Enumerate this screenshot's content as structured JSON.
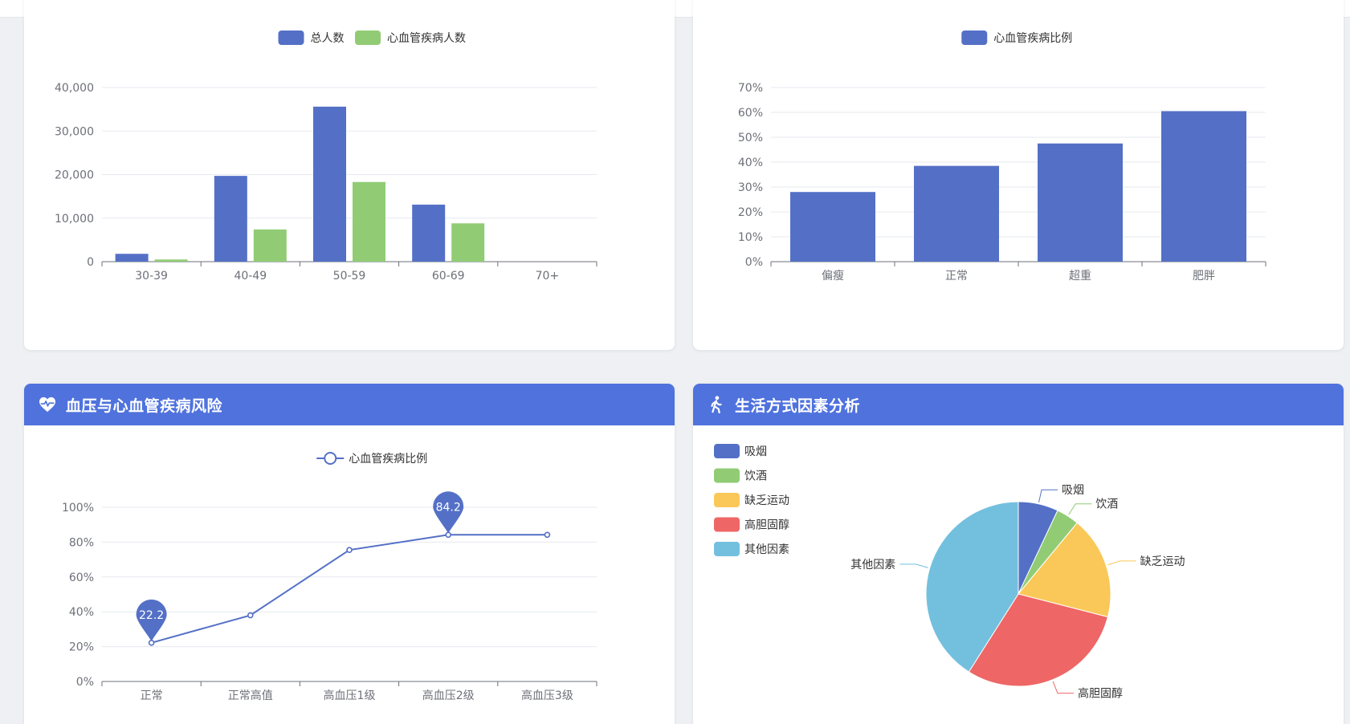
{
  "colors": {
    "blue": "#5470c6",
    "green": "#91cc75",
    "yellow": "#fac858",
    "red": "#ee6666",
    "cyan": "#73c0de",
    "header": "#4f72dd",
    "axis": "#6e7079",
    "grid": "#e6e9ef"
  },
  "cards": {
    "age": {
      "title": ""
    },
    "bmi": {
      "title": ""
    },
    "bp": {
      "title": "血压与心血管疾病风险",
      "icon": "heart-pulse-icon"
    },
    "life": {
      "title": "生活方式因素分析",
      "icon": "walking-person-icon"
    }
  },
  "chart_data": [
    {
      "id": "age",
      "type": "bar",
      "categories": [
        "30-39",
        "40-49",
        "50-59",
        "60-69",
        "70+"
      ],
      "series": [
        {
          "name": "总人数",
          "values": [
            1800,
            19700,
            35600,
            13100,
            0
          ]
        },
        {
          "name": "心血管疾病人数",
          "values": [
            500,
            7400,
            18300,
            8800,
            0
          ]
        }
      ],
      "ylim": [
        0,
        40000
      ],
      "yticks": [
        0,
        10000,
        20000,
        30000,
        40000
      ],
      "ytick_labels": [
        "0",
        "10,000",
        "20,000",
        "30,000",
        "40,000"
      ],
      "legend": "top-center",
      "grid": true
    },
    {
      "id": "bmi",
      "type": "bar",
      "categories": [
        "偏瘦",
        "正常",
        "超重",
        "肥胖"
      ],
      "series": [
        {
          "name": "心血管疾病比例",
          "values": [
            28,
            38.5,
            47.5,
            60.5
          ]
        }
      ],
      "ylim": [
        0,
        70
      ],
      "yticks": [
        0,
        10,
        20,
        30,
        40,
        50,
        60,
        70
      ],
      "ytick_labels": [
        "0%",
        "10%",
        "20%",
        "30%",
        "40%",
        "50%",
        "60%",
        "70%"
      ],
      "legend": "top-center",
      "grid": true
    },
    {
      "id": "bp",
      "type": "line",
      "categories": [
        "正常",
        "正常高值",
        "高血压1级",
        "高血压2级",
        "高血压3级"
      ],
      "series": [
        {
          "name": "心血管疾病比例",
          "values": [
            22.2,
            38,
            75.5,
            84.2,
            84.2
          ]
        }
      ],
      "ylim": [
        0,
        100
      ],
      "yticks": [
        0,
        20,
        40,
        60,
        80,
        100
      ],
      "ytick_labels": [
        "0%",
        "20%",
        "40%",
        "60%",
        "80%",
        "100%"
      ],
      "markers": [
        {
          "index": 0,
          "label": "22.2"
        },
        {
          "index": 3,
          "label": "84.2"
        }
      ],
      "legend": "top-center",
      "grid": true
    },
    {
      "id": "life",
      "type": "pie",
      "categories": [
        "吸烟",
        "饮酒",
        "缺乏运动",
        "高胆固醇",
        "其他因素"
      ],
      "values": [
        7,
        4,
        18,
        30,
        41
      ],
      "legend": "top-left"
    }
  ]
}
